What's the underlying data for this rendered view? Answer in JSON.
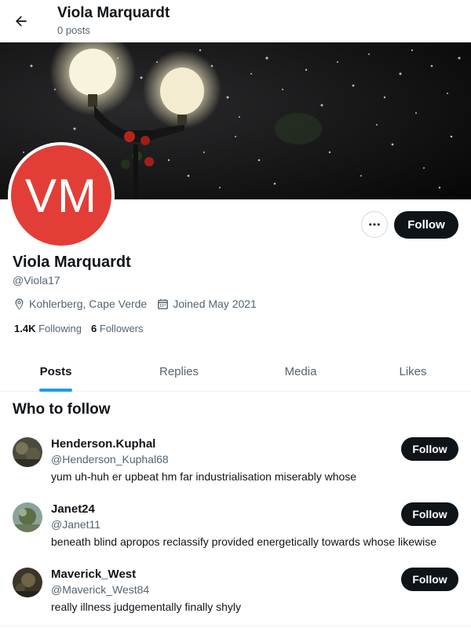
{
  "header": {
    "title": "Viola Marquardt",
    "post_count": "0 posts"
  },
  "profile": {
    "avatar_initials": "VM",
    "avatar_color": "#e23e37",
    "name": "Viola Marquardt",
    "handle": "@Viola17",
    "location": "Kohlerberg, Cape Verde",
    "joined": "Joined May 2021",
    "following_count": "1.4K",
    "following_label": "Following",
    "followers_count": "6",
    "followers_label": "Followers",
    "follow_label": "Follow"
  },
  "tabs": [
    {
      "label": "Posts",
      "active": true
    },
    {
      "label": "Replies",
      "active": false
    },
    {
      "label": "Media",
      "active": false
    },
    {
      "label": "Likes",
      "active": false
    }
  ],
  "who_to_follow": {
    "title": "Who to follow",
    "items": [
      {
        "name": "Henderson.Kuphal",
        "handle": "@Henderson_Kuphal68",
        "bio": "yum uh-huh er upbeat hm far industrialisation miserably whose",
        "follow_label": "Follow"
      },
      {
        "name": "Janet24",
        "handle": "@Janet11",
        "bio": "beneath blind apropos reclassify provided energetically towards whose likewise",
        "follow_label": "Follow"
      },
      {
        "name": "Maverick_West",
        "handle": "@Maverick_West84",
        "bio": "really illness judgementally finally shyly",
        "follow_label": "Follow"
      }
    ]
  },
  "colors": {
    "accent": "#1d9bf0",
    "text": "#0f1419",
    "muted": "#536471",
    "button_dark": "#0f1419"
  },
  "icons": {
    "back": "arrow-left-icon",
    "more": "more-horizontal-icon",
    "location": "location-pin-icon",
    "calendar": "calendar-icon"
  }
}
